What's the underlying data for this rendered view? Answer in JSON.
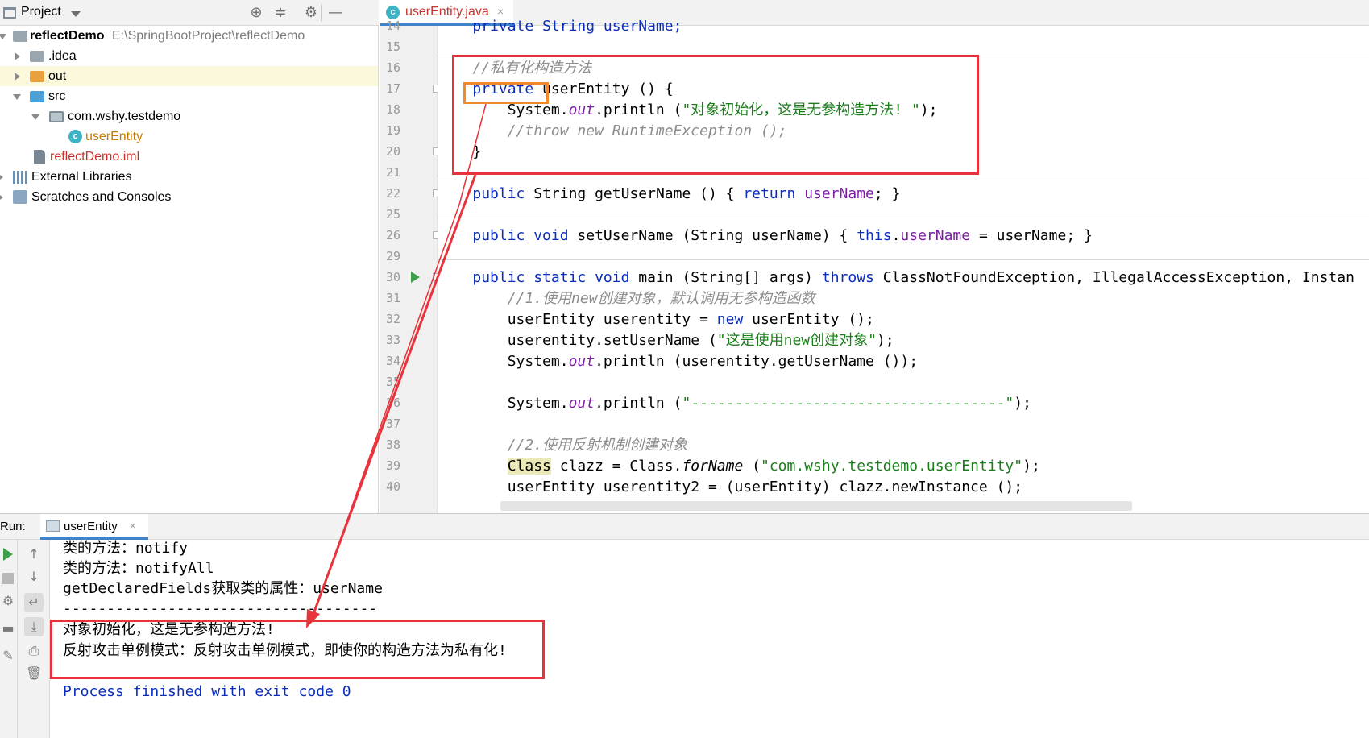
{
  "project_panel": {
    "title": "Project",
    "tree": [
      {
        "label": "reflectDemo",
        "path": "E:\\SpringBootProject\\reflectDemo"
      },
      {
        "label": ".idea"
      },
      {
        "label": "out"
      },
      {
        "label": "src"
      },
      {
        "label": "com.wshy.testdemo"
      },
      {
        "label": "userEntity"
      },
      {
        "label": "reflectDemo.iml"
      },
      {
        "label": "External Libraries"
      },
      {
        "label": "Scratches and Consoles"
      }
    ]
  },
  "editor": {
    "tab": {
      "label": "userEntity.java",
      "close": "×"
    },
    "gutter_numbers": [
      "14",
      "15",
      "16",
      "17",
      "18",
      "19",
      "20",
      "21",
      "22",
      "25",
      "26",
      "29",
      "30",
      "31",
      "32",
      "33",
      "34",
      "35",
      "36",
      "37",
      "38",
      "39",
      "40"
    ],
    "code": {
      "l14": "    private String userName;",
      "l16": "    //私有化构造方法",
      "l17_kw": "private",
      "l17_rest": " userEntity () {",
      "l18_a": "        System.",
      "l18_out": "out",
      "l18_b": ".println (",
      "l18_str": "\"对象初始化，这是无参构造方法! \"",
      "l18_c": ");",
      "l19": "        //throw new RuntimeException ();",
      "l20": "    }",
      "l22_kw": "public",
      "l22_a": " String getUserName () { ",
      "l22_ret": "return",
      "l22_fld": " userName",
      "l22_b": "; }",
      "l26_kw": "public void",
      "l26_a": " setUserName (String userName) { ",
      "l26_this": "this",
      "l26_dot": ".",
      "l26_fld": "userName",
      "l26_b": " = userName; }",
      "l30_kw": "public static void",
      "l30_a": " main (String[] args) ",
      "l30_throws": "throws",
      "l30_b": " ClassNotFoundException, IllegalAccessException, Instan",
      "l31": "        //1.使用new创建对象，默认调用无参构造函数",
      "l32_a": "        userEntity userentity = ",
      "l32_new": "new",
      "l32_b": " userEntity ();",
      "l33_a": "        userentity.setUserName (",
      "l33_str": "\"这是使用new创建对象\"",
      "l33_b": ");",
      "l34_a": "        System.",
      "l34_out": "out",
      "l34_b": ".println (userentity.getUserName ());",
      "l36_a": "        System.",
      "l36_out": "out",
      "l36_b": ".println (",
      "l36_str": "\"------------------------------------\"",
      "l36_c": ");",
      "l38": "        //2.使用反射机制创建对象",
      "l39_pad": "        ",
      "l39_cls": "Class",
      "l39_a": " clazz = Class.",
      "l39_fn": "forName",
      "l39_b": " (",
      "l39_str": "\"com.wshy.testdemo.userEntity\"",
      "l39_c": ");",
      "l40": "        userEntity userentity2 = (userEntity) clazz.newInstance ();"
    }
  },
  "run_panel": {
    "prefix": "Run:",
    "tab_label": "userEntity",
    "tab_close": "×",
    "lines": [
      "类的方法：notify",
      "类的方法：notifyAll",
      "getDeclaredFields获取类的属性：userName",
      "------------------------------------",
      "对象初始化，这是无参构造方法!",
      "反射攻击单例模式：反射攻击单例模式，即使你的构造方法为私有化!",
      "",
      "Process finished with exit code 0"
    ]
  },
  "colors": {
    "annotation_red": "#e8333c",
    "annotation_orange": "#f08a2c",
    "keyword": "#0a2dbe",
    "string": "#1a7d1a",
    "field": "#7a1fa2",
    "comment": "#8c8c8c"
  },
  "icons": [
    "project-icon",
    "locate-icon",
    "collapse-icon",
    "gear-icon",
    "minimize-icon",
    "run-icon",
    "stop-icon",
    "soft-wrap-icon",
    "scroll-to-end-icon",
    "print-icon",
    "trash-icon",
    "pin-icon",
    "arrow-up-icon",
    "arrow-down-icon"
  ]
}
